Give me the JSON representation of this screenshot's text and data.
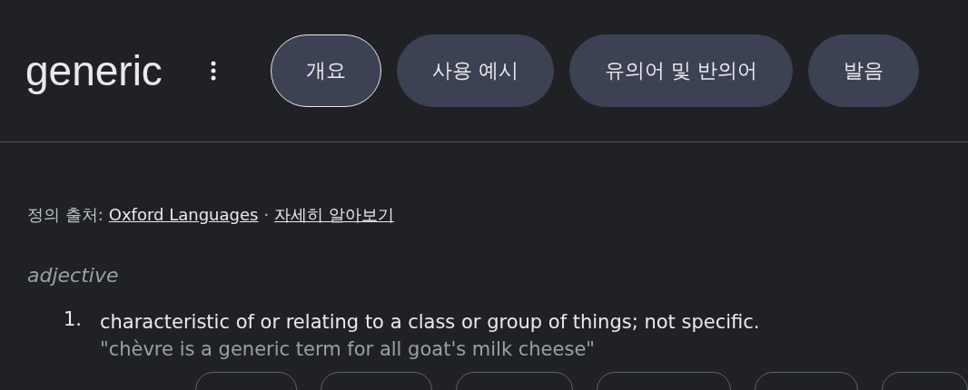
{
  "title": "generic",
  "tabs": [
    {
      "label": "개요",
      "selected": true
    },
    {
      "label": "사용 예시",
      "selected": false
    },
    {
      "label": "유의어 및 반의어",
      "selected": false
    },
    {
      "label": "발음",
      "selected": false
    }
  ],
  "source": {
    "label": "정의 출처:",
    "link": "Oxford Languages",
    "separator": "·",
    "more_link": "자세히 알아보기"
  },
  "word_class": "adjective",
  "definitions": [
    {
      "number": "1.",
      "text": "characteristic of or relating to a class or group of things; not specific.",
      "example": "\"chèvre is a generic term for all goat's milk cheese\""
    }
  ]
}
